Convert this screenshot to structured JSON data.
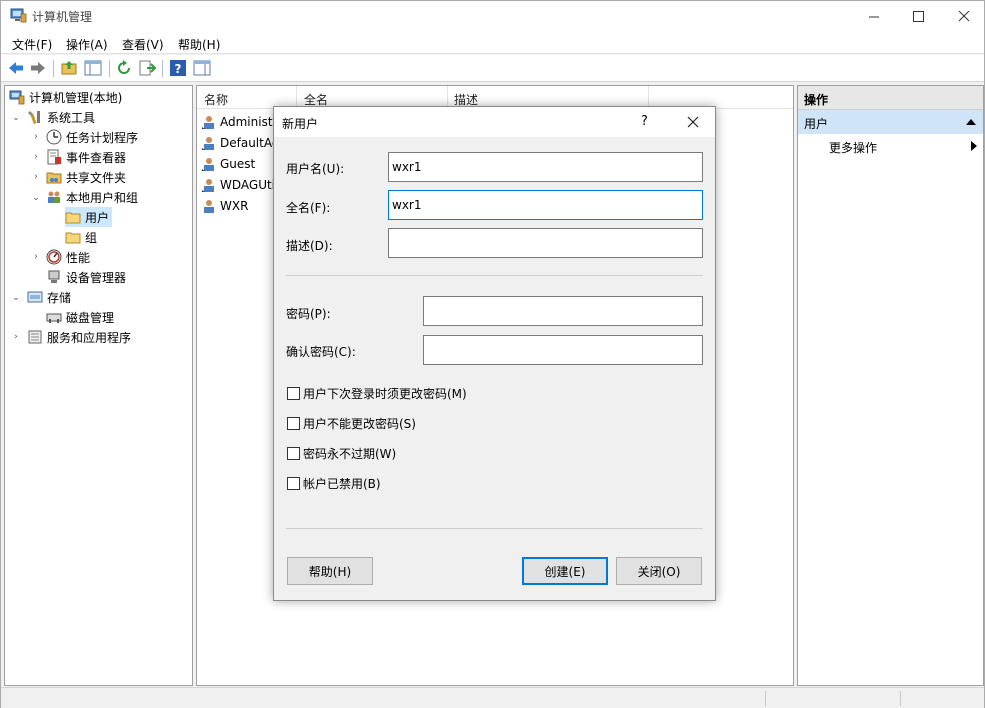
{
  "window": {
    "title": "计算机管理"
  },
  "menu": [
    "文件(F)",
    "操作(A)",
    "查看(V)",
    "帮助(H)"
  ],
  "tree": {
    "root": "计算机管理(本地)",
    "system_tools": "系统工具",
    "task_scheduler": "任务计划程序",
    "event_viewer": "事件查看器",
    "shared_folders": "共享文件夹",
    "local_users_groups": "本地用户和组",
    "users": "用户",
    "groups": "组",
    "performance": "性能",
    "device_manager": "设备管理器",
    "storage": "存储",
    "disk_management": "磁盘管理",
    "services_apps": "服务和应用程序"
  },
  "list": {
    "columns": [
      "名称",
      "全名",
      "描述"
    ],
    "rows": [
      "Administr",
      "DefaultAc",
      "Guest",
      "WDAGUti",
      "WXR"
    ]
  },
  "actions": {
    "header": "操作",
    "section": "用户",
    "more": "更多操作"
  },
  "dialog": {
    "title": "新用户",
    "help_glyph": "?",
    "close_glyph": "✕",
    "username_label": "用户名(U):",
    "username_value": "wxr1",
    "fullname_label": "全名(F):",
    "fullname_value": "wxr1",
    "description_label": "描述(D):",
    "description_value": "",
    "password_label": "密码(P):",
    "confirm_label": "确认密码(C):",
    "checkboxes": [
      "用户下次登录时须更改密码(M)",
      "用户不能更改密码(S)",
      "密码永不过期(W)",
      "帐户已禁用(B)"
    ],
    "help_button": "帮助(H)",
    "create_button": "创建(E)",
    "close_button": "关闭(O)"
  },
  "colors": {
    "accent": "#0078d7",
    "selection": "#cce8ff",
    "action_section": "#cfe4f7"
  }
}
